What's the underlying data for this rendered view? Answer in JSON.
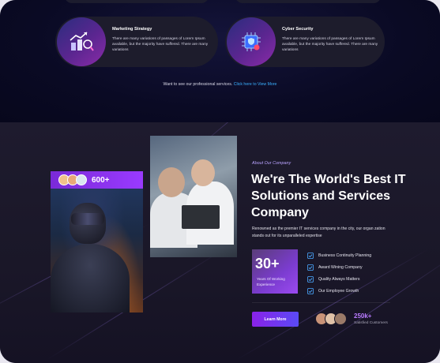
{
  "services": {
    "cards": [
      {
        "title": "Marketing Strategy",
        "description": "There are many variations of passages of Lorem Ipsum available, but the majority have suffered. There are many variations",
        "icon": "marketing-chart-icon"
      },
      {
        "title": "Cyber Security",
        "description": "There are many variations of passages of Lorem Ipsum available, but the majority have suffered. There are many variations",
        "icon": "cyber-chip-icon"
      }
    ],
    "cta_text": "Want to see our professional services. ",
    "cta_link": "Click here to View More"
  },
  "about": {
    "counter": "600+",
    "eyebrow": "About Our Company",
    "heading": "We're The World's Best IT Solutions and Services Company",
    "description": "Renowned as the premier IT services company in the city, our organ zation stands out for its unparalleled expertise",
    "experience": {
      "number": "30+",
      "label": "Years Of Working Experience"
    },
    "checklist": [
      "Business Continuity Planning",
      "Award Wining Company",
      "Quality Always Matters",
      "Our Employee Growth"
    ],
    "button_label": "Learn More",
    "customers": {
      "count": "250k+",
      "label": "Satisfied Customers"
    }
  },
  "colors": {
    "accent_purple": "#8a22e8",
    "link_blue": "#3ab0ff",
    "check_blue": "#4aa8ff"
  }
}
